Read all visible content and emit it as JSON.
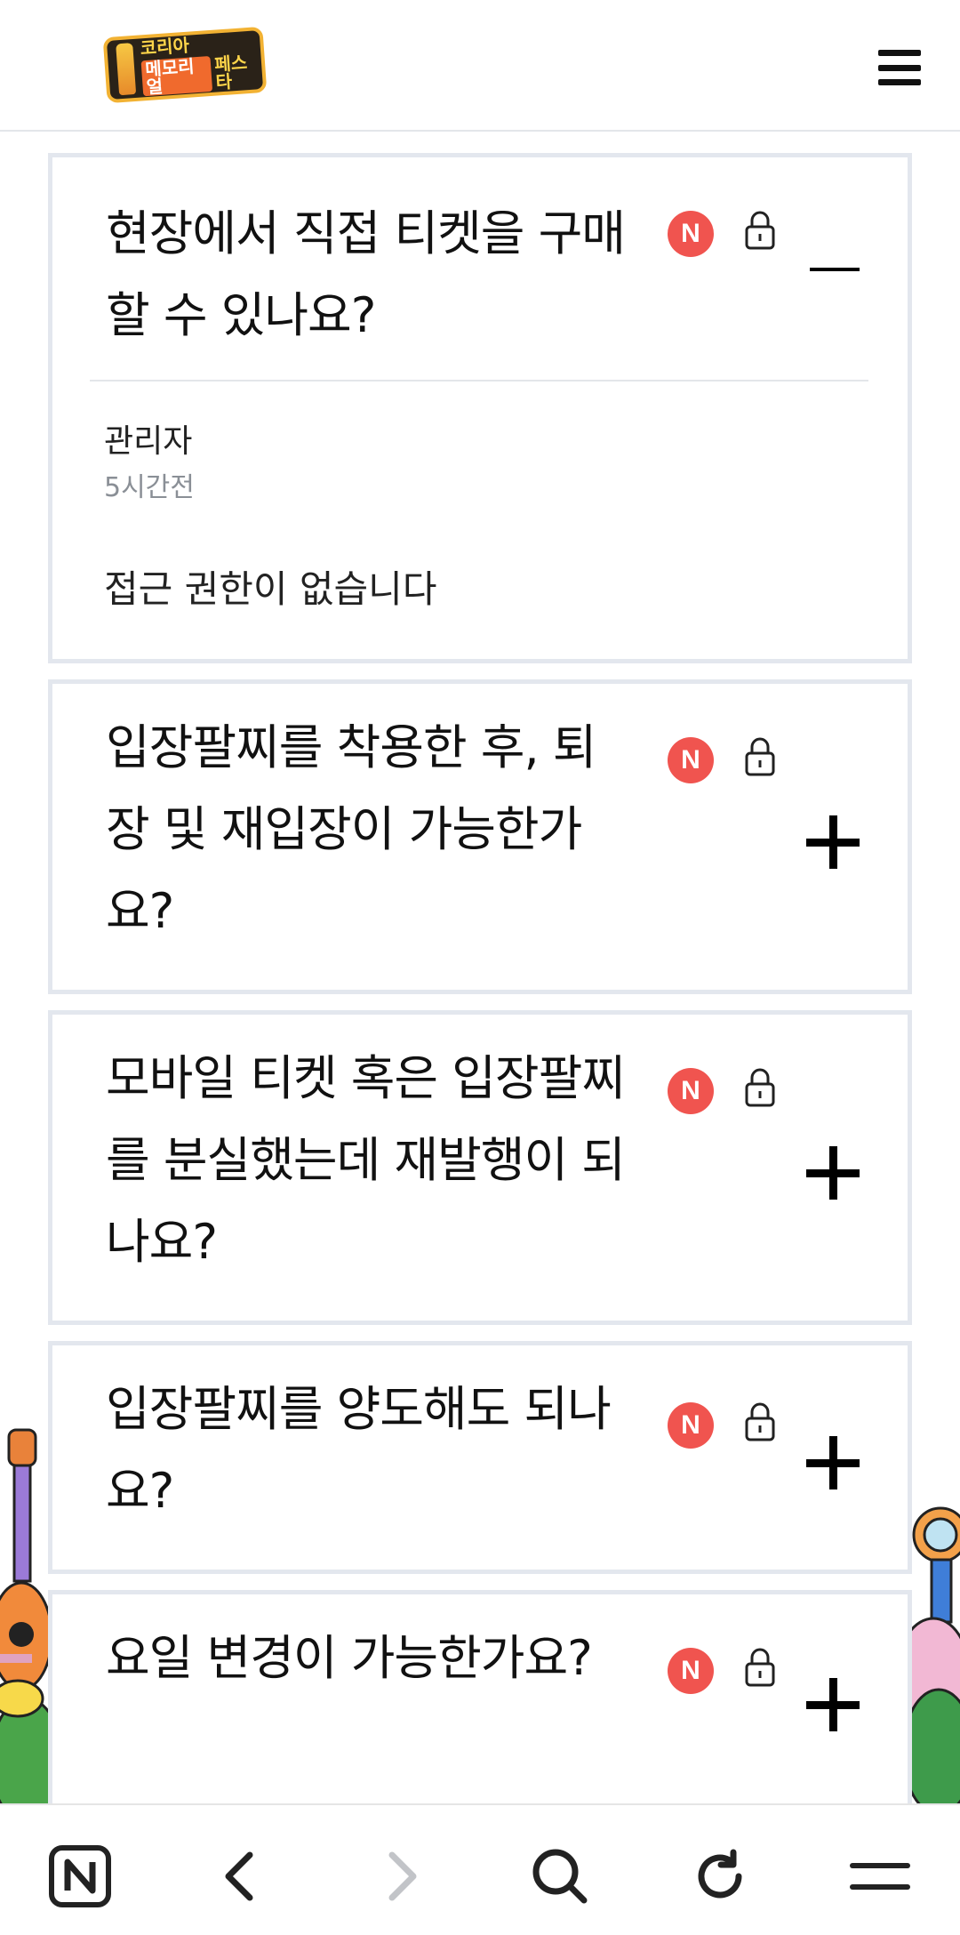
{
  "header": {
    "logo_line1": "코리아",
    "logo_line2a": "메모리얼",
    "logo_line2b": "페스타"
  },
  "faq": {
    "items": [
      {
        "question": "현장에서 직접 티켓을 구매할 수 있나요?",
        "badge": "N",
        "expanded": true,
        "answer": {
          "author": "관리자",
          "time": "5시간전",
          "body": "접근 권한이 없습니다"
        }
      },
      {
        "question": "입장팔찌를 착용한 후, 퇴장 및 재입장이 가능한가요?",
        "badge": "N",
        "expanded": false
      },
      {
        "question": "모바일 티켓 혹은 입장팔찌를 분실했는데 재발행이 되나요?",
        "badge": "N",
        "expanded": false
      },
      {
        "question": "입장팔찌를 양도해도 되나요?",
        "badge": "N",
        "expanded": false
      },
      {
        "question": "요일 변경이 가능한가요?",
        "badge": "N",
        "expanded": false
      }
    ]
  },
  "bottom_bar": {
    "icons": [
      "naver-home-icon",
      "back-arrow-icon",
      "forward-arrow-icon",
      "search-icon",
      "refresh-icon",
      "menu-icon"
    ],
    "forward_enabled": false
  },
  "colors": {
    "badge": "#f0544f",
    "card_border": "#e3e7ee",
    "text": "#111111",
    "muted": "#8a8f96"
  }
}
